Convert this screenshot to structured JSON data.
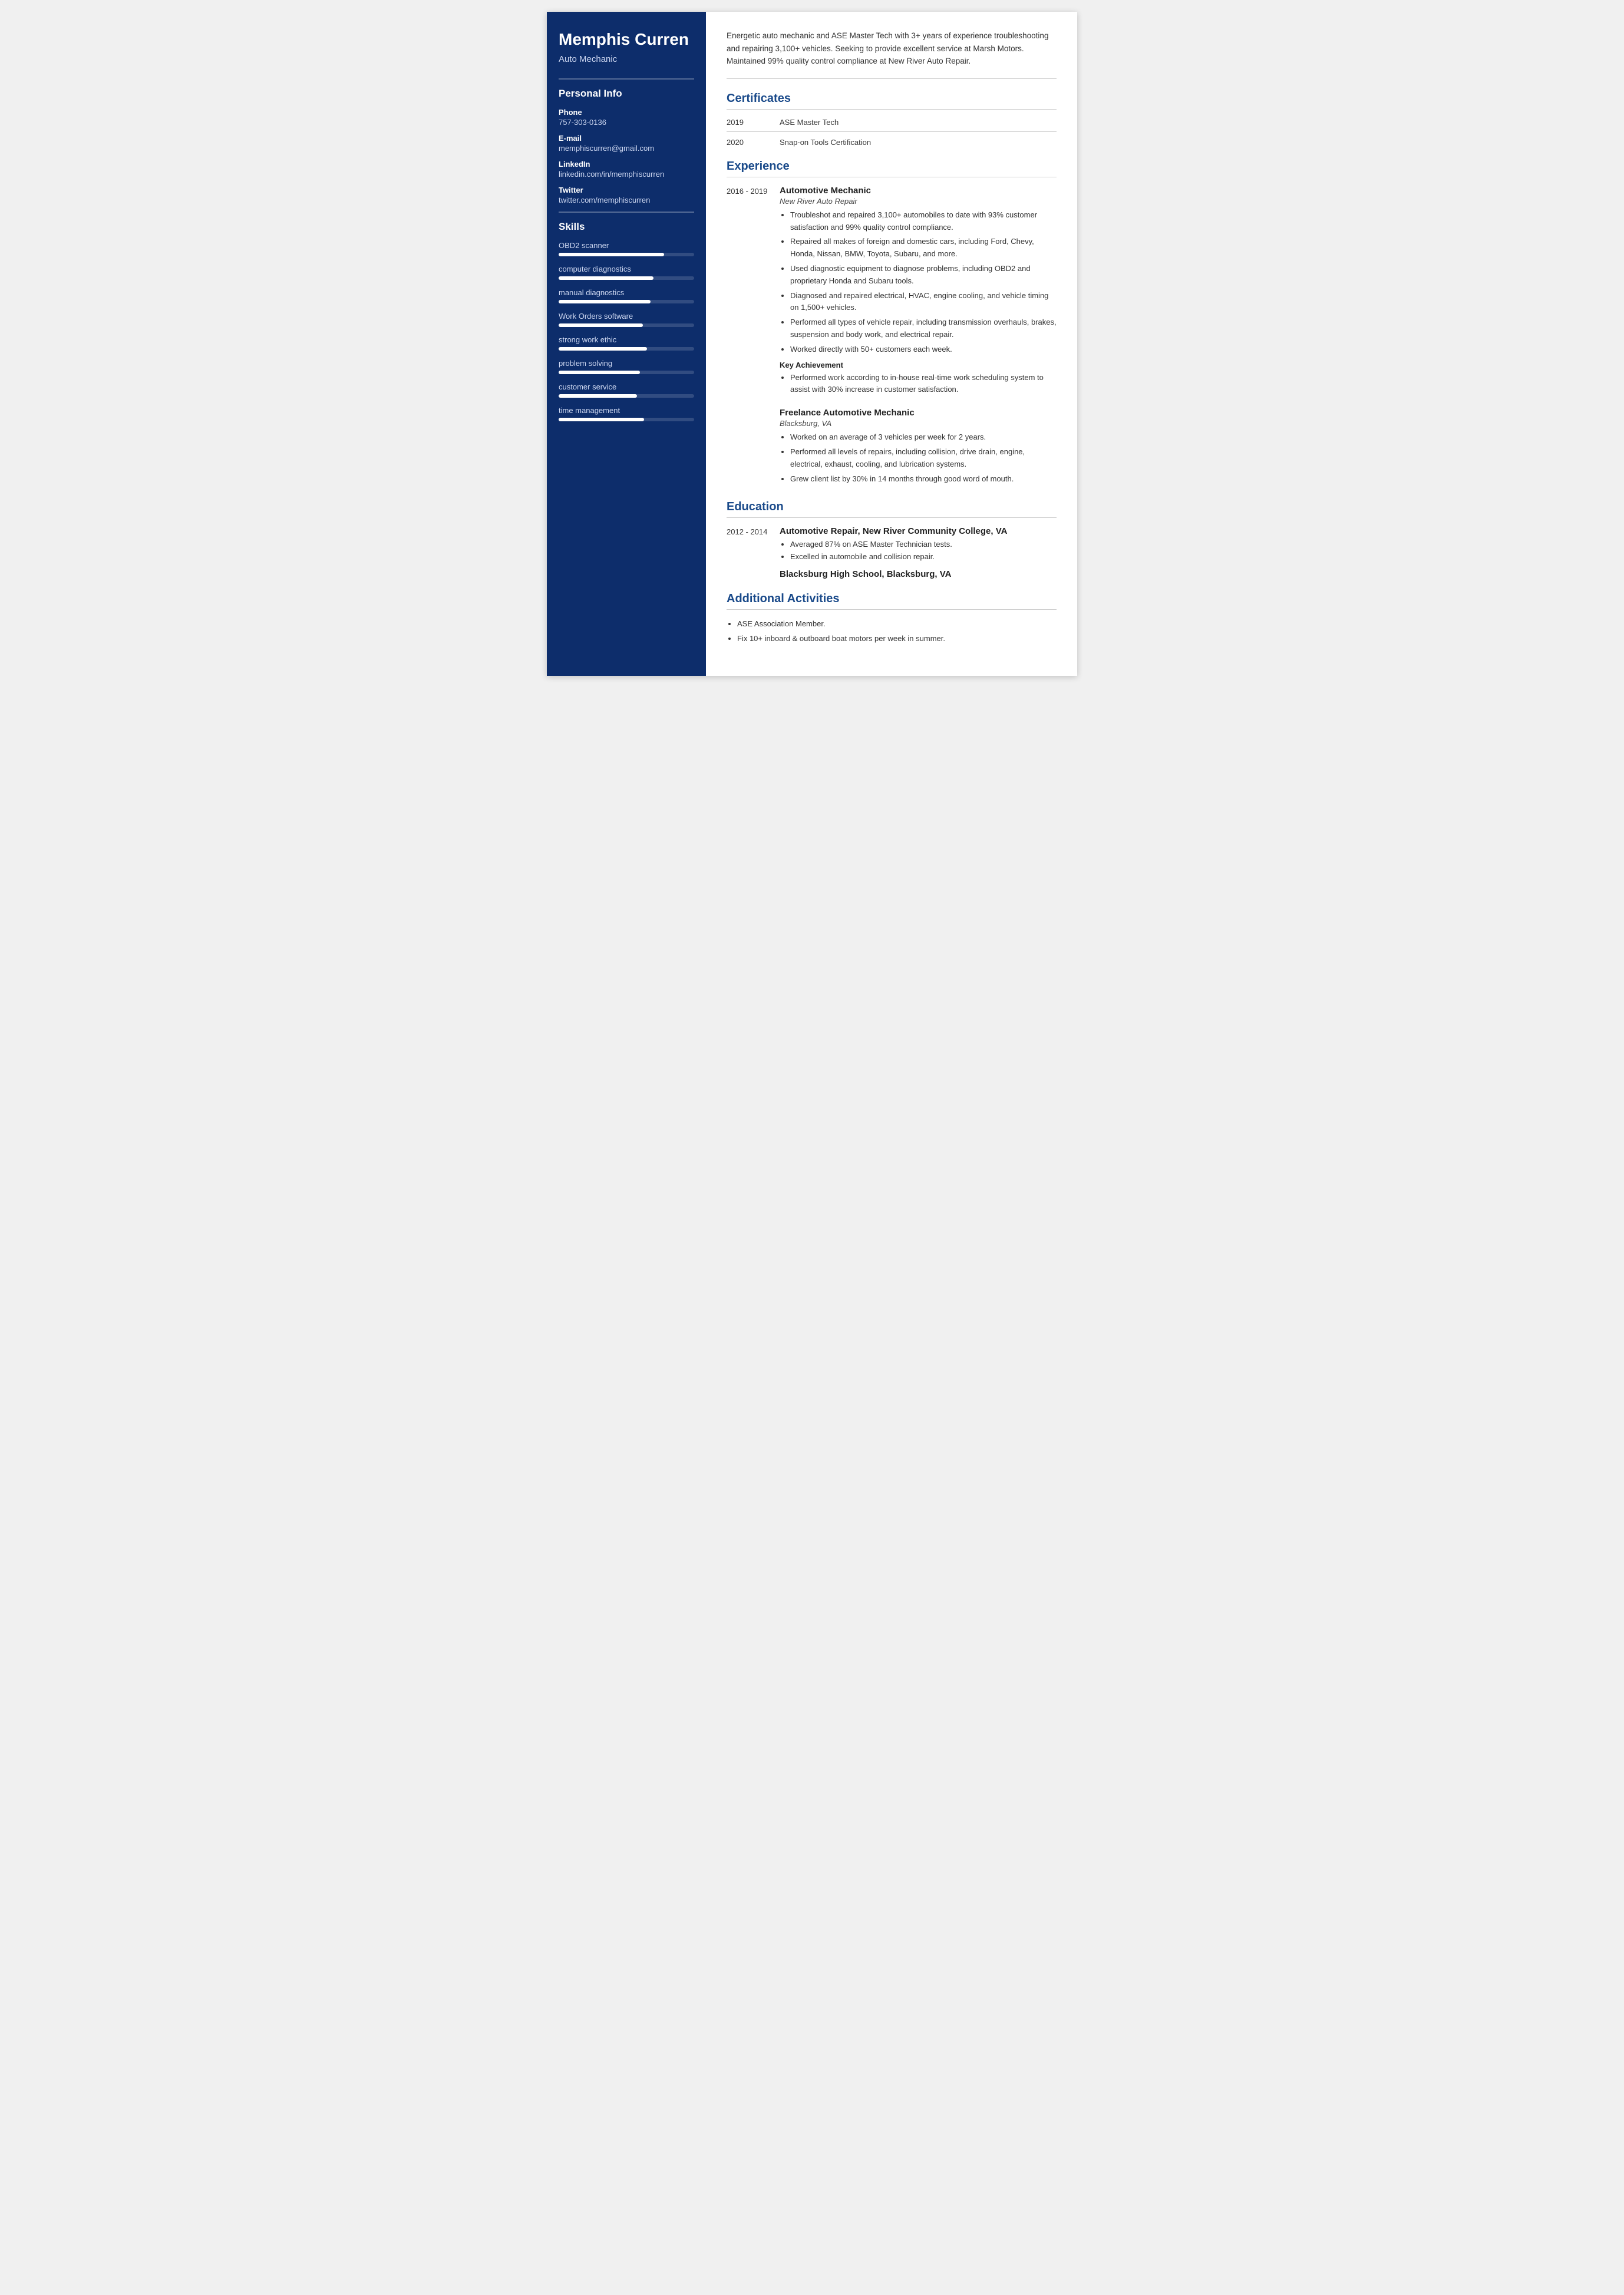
{
  "sidebar": {
    "name": "Memphis Curren",
    "title": "Auto Mechanic",
    "personal_info_label": "Personal Info",
    "phone_label": "Phone",
    "phone": "757-303-0136",
    "email_label": "E-mail",
    "email": "memphiscurren@gmail.com",
    "linkedin_label": "LinkedIn",
    "linkedin": "linkedin.com/in/memphiscurren",
    "twitter_label": "Twitter",
    "twitter": "twitter.com/memphiscurren",
    "skills_label": "Skills",
    "skills": [
      {
        "name": "OBD2 scanner",
        "pct": 78
      },
      {
        "name": "computer diagnostics",
        "pct": 70
      },
      {
        "name": "manual diagnostics",
        "pct": 68
      },
      {
        "name": "Work Orders software",
        "pct": 62
      },
      {
        "name": "strong work ethic",
        "pct": 65
      },
      {
        "name": "problem solving",
        "pct": 60
      },
      {
        "name": "customer service",
        "pct": 58
      },
      {
        "name": "time management",
        "pct": 63
      }
    ]
  },
  "main": {
    "summary": "Energetic auto mechanic and ASE Master Tech with 3+ years of experience troubleshooting and repairing 3,100+ vehicles. Seeking to provide excellent service at Marsh Motors. Maintained 99% quality control compliance at New River Auto Repair.",
    "certificates_label": "Certificates",
    "certificates": [
      {
        "year": "2019",
        "name": "ASE Master Tech"
      },
      {
        "year": "2020",
        "name": "Snap-on Tools Certification"
      }
    ],
    "experience_label": "Experience",
    "jobs": [
      {
        "dates": "2016 - 2019",
        "title": "Automotive Mechanic",
        "company": "New River Auto Repair",
        "bullets": [
          "Troubleshot and repaired 3,100+ automobiles to date with 93% customer satisfaction and 99% quality control compliance.",
          "Repaired all makes of foreign and domestic cars, including Ford, Chevy, Honda, Nissan, BMW, Toyota, Subaru, and more.",
          "Used diagnostic equipment to diagnose problems, including OBD2 and proprietary Honda and Subaru tools.",
          "Diagnosed and repaired electrical, HVAC, engine cooling, and vehicle timing on 1,500+ vehicles.",
          "Performed all types of vehicle repair, including transmission overhauls, brakes, suspension and body work, and electrical repair.",
          "Worked directly with 50+ customers each week."
        ],
        "achievement_label": "Key Achievement",
        "achievement_bullets": [
          "Performed work according to in-house real-time work scheduling system to assist with 30% increase in customer satisfaction."
        ]
      },
      {
        "dates": "",
        "title": "Freelance Automotive Mechanic",
        "company": "Blacksburg, VA",
        "bullets": [
          "Worked on an average of 3 vehicles per week for 2 years.",
          "Performed all levels of repairs, including collision, drive drain, engine, electrical, exhaust, cooling, and lubrication systems.",
          "Grew client list by 30% in 14 months through good word of mouth."
        ],
        "achievement_label": null,
        "achievement_bullets": []
      }
    ],
    "education_label": "Education",
    "education": [
      {
        "dates": "2012 - 2014",
        "title": "Automotive Repair, New River Community College, VA",
        "bullets": [
          "Averaged 87% on ASE Master Technician tests.",
          "Excelled in automobile and collision repair."
        ]
      }
    ],
    "education_extra": "Blacksburg High School, Blacksburg, VA",
    "additional_label": "Additional Activities",
    "additional_bullets": [
      "ASE Association Member.",
      "Fix 10+ inboard & outboard boat motors per week in summer."
    ]
  }
}
